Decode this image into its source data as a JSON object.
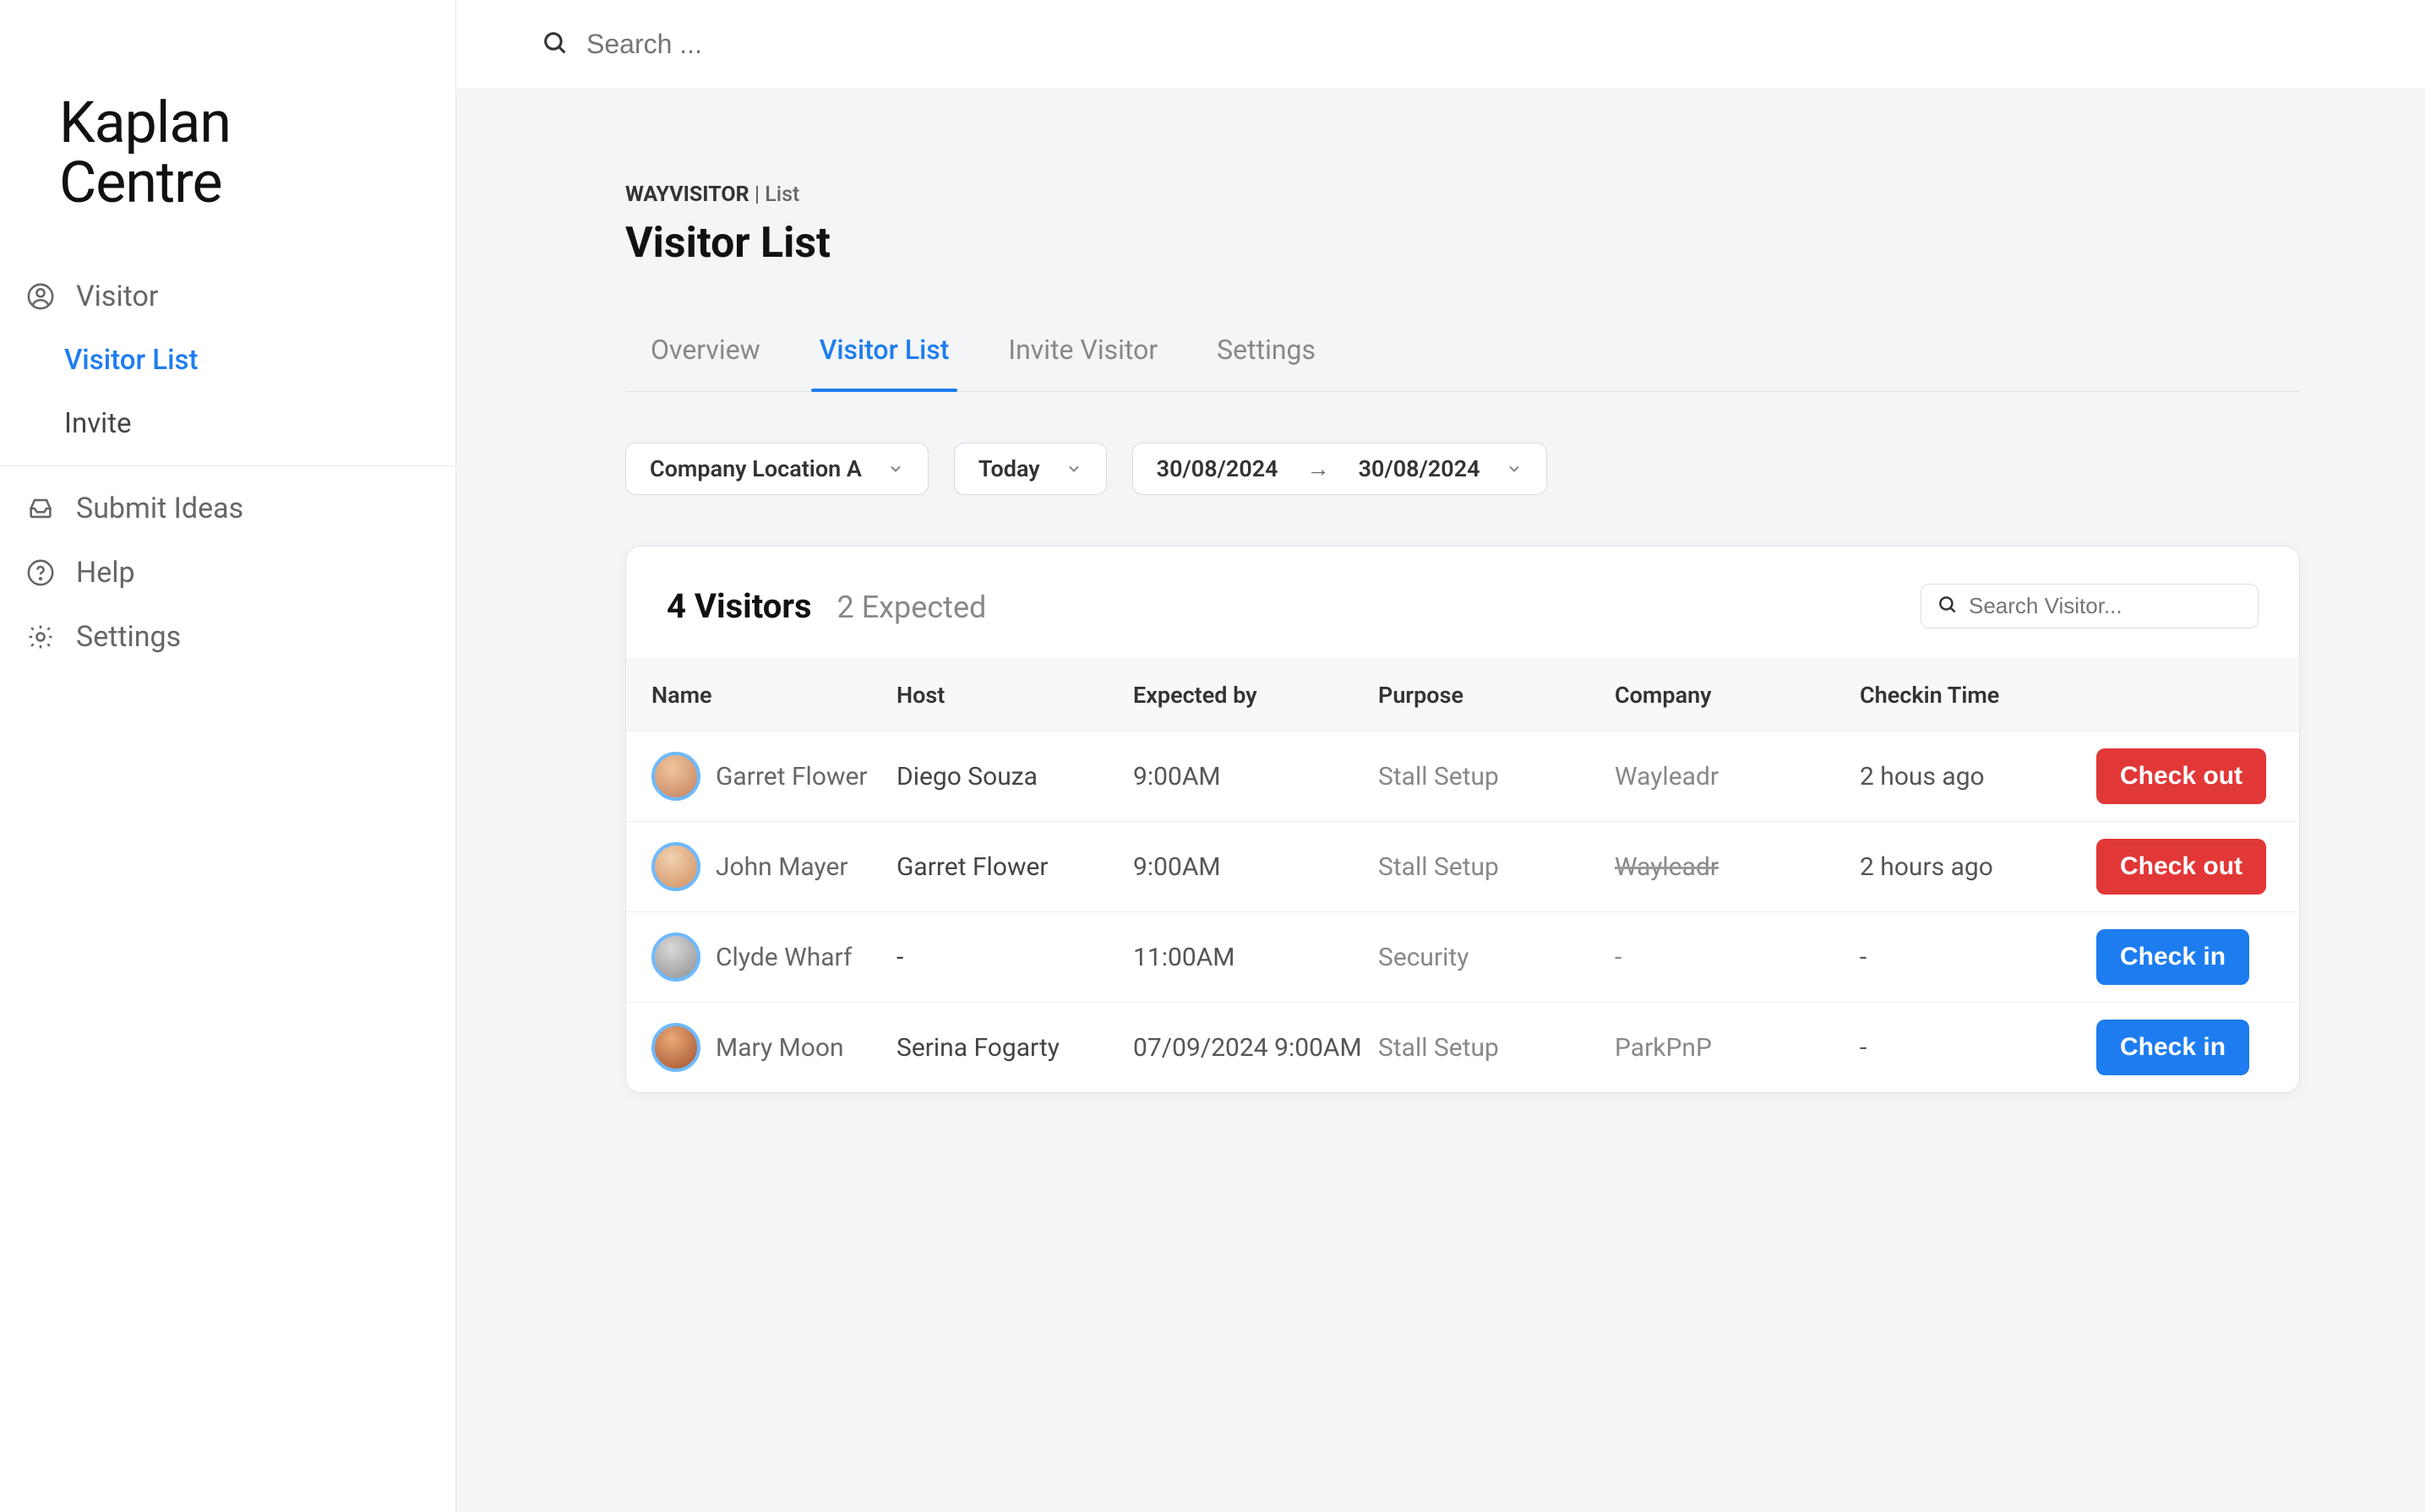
{
  "brand": {
    "line1": "Kaplan",
    "line2": "Centre"
  },
  "search": {
    "placeholder": "Search ..."
  },
  "sidebar": {
    "visitor_label": "Visitor",
    "visitor_list_label": "Visitor List",
    "invite_label": "Invite",
    "submit_ideas_label": "Submit Ideas",
    "help_label": "Help",
    "settings_label": "Settings"
  },
  "breadcrumb": {
    "root": "WAYVISITOR",
    "sep": " | ",
    "leaf": "List"
  },
  "page_title": "Visitor List",
  "tabs": {
    "overview": "Overview",
    "visitor_list": "Visitor List",
    "invite_visitor": "Invite Visitor",
    "settings": "Settings"
  },
  "filters": {
    "location": "Company Location A",
    "period": "Today",
    "date_from": "30/08/2024",
    "date_to": "30/08/2024"
  },
  "card": {
    "visitors_count": "4 Visitors",
    "expected_count": "2 Expected",
    "search_placeholder": "Search Visitor..."
  },
  "columns": {
    "name": "Name",
    "host": "Host",
    "expected_by": "Expected by",
    "purpose": "Purpose",
    "company": "Company",
    "checkin_time": "Checkin Time"
  },
  "buttons": {
    "check_out": "Check out",
    "check_in": "Check in"
  },
  "rows": [
    {
      "name": "Garret Flower",
      "host": "Diego Souza",
      "expected": "9:00AM",
      "purpose": "Stall Setup",
      "company": "Wayleadr",
      "company_strike": false,
      "checkin": "2 hous ago",
      "action": "out",
      "avatar": "a1"
    },
    {
      "name": "John Mayer",
      "host": "Garret Flower",
      "expected": "9:00AM",
      "purpose": "Stall Setup",
      "company": "Wayleadr",
      "company_strike": true,
      "checkin": "2 hours ago",
      "action": "out",
      "avatar": "a2"
    },
    {
      "name": "Clyde Wharf",
      "host": "-",
      "expected": "11:00AM",
      "purpose": "Security",
      "company": "-",
      "company_strike": false,
      "checkin": "-",
      "action": "in",
      "avatar": "a3"
    },
    {
      "name": "Mary Moon",
      "host": "Serina Fogarty",
      "expected": "07/09/2024 9:00AM",
      "purpose": "Stall Setup",
      "company": "ParkPnP",
      "company_strike": false,
      "checkin": "-",
      "action": "in",
      "avatar": "a4"
    }
  ]
}
